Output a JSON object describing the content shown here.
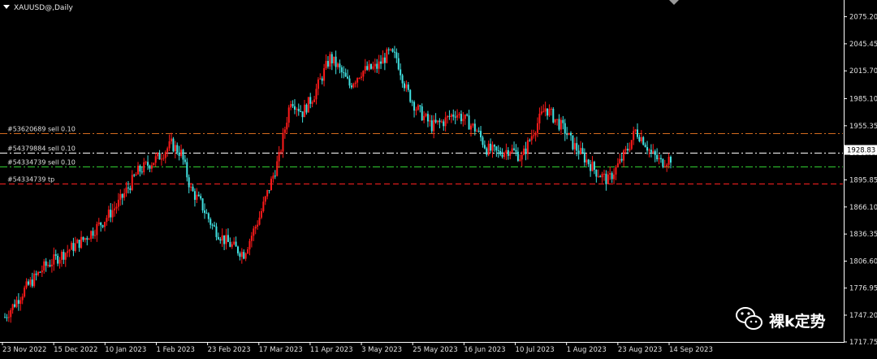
{
  "window": {
    "title": "XAUUSD@,Daily"
  },
  "watermark": {
    "text": "裸k定势"
  },
  "chart_data": {
    "type": "candlestick",
    "symbol": "XAUUSD@",
    "timeframe": "Daily",
    "ylim": [
      1717.75,
      2090
    ],
    "y_ticks": [
      "2075.20",
      "2045.45",
      "2015.70",
      "1985.10",
      "1955.35",
      "1925.60",
      "1895.85",
      "1866.10",
      "1836.35",
      "1806.60",
      "1776.95",
      "1747.20",
      "1717.75"
    ],
    "x_ticks": [
      "23 Nov 2022",
      "15 Dec 2022",
      "10 Jan 2023",
      "1 Feb 2023",
      "23 Feb 2023",
      "17 Mar 2023",
      "11 Apr 2023",
      "3 May 2023",
      "25 May 2023",
      "16 Jun 2023",
      "10 Jul 2023",
      "1 Aug 2023",
      "23 Aug 2023",
      "14 Sep 2023"
    ],
    "current_price": "1928.83",
    "colors": {
      "bull": "#ff1a1a",
      "bear": "#40e0e0",
      "background": "#000000",
      "axis": "#ffffff"
    },
    "key_points": [
      [
        0,
        1745
      ],
      [
        10,
        1775
      ],
      [
        20,
        1800
      ],
      [
        30,
        1815
      ],
      [
        40,
        1830
      ],
      [
        50,
        1850
      ],
      [
        58,
        1870
      ],
      [
        68,
        1905
      ],
      [
        78,
        1920
      ],
      [
        85,
        1935
      ],
      [
        90,
        1925
      ],
      [
        95,
        1885
      ],
      [
        100,
        1870
      ],
      [
        106,
        1845
      ],
      [
        112,
        1830
      ],
      [
        118,
        1820
      ],
      [
        122,
        1815
      ],
      [
        130,
        1855
      ],
      [
        140,
        1920
      ],
      [
        146,
        1985
      ],
      [
        152,
        1970
      ],
      [
        158,
        1990
      ],
      [
        166,
        2030
      ],
      [
        170,
        2020
      ],
      [
        176,
        2000
      ],
      [
        182,
        2015
      ],
      [
        190,
        2020
      ],
      [
        196,
        2035
      ],
      [
        200,
        2030
      ],
      [
        205,
        1995
      ],
      [
        210,
        1975
      ],
      [
        218,
        1955
      ],
      [
        224,
        1960
      ],
      [
        230,
        1970
      ],
      [
        236,
        1960
      ],
      [
        241,
        1950
      ],
      [
        246,
        1930
      ],
      [
        252,
        1925
      ],
      [
        258,
        1930
      ],
      [
        264,
        1920
      ],
      [
        270,
        1950
      ],
      [
        276,
        1975
      ],
      [
        280,
        1965
      ],
      [
        286,
        1950
      ],
      [
        290,
        1935
      ],
      [
        296,
        1920
      ],
      [
        302,
        1905
      ],
      [
        308,
        1895
      ],
      [
        314,
        1915
      ],
      [
        318,
        1930
      ],
      [
        322,
        1950
      ],
      [
        326,
        1940
      ],
      [
        330,
        1925
      ],
      [
        335,
        1915
      ],
      [
        340,
        1920
      ]
    ],
    "orders": [
      {
        "label": "#53620689 sell 0.10",
        "price": 1947.5,
        "color": "#d2691e",
        "style": "dash-dot"
      },
      {
        "label": "#54379884 sell 0.10",
        "price": 1925.6,
        "color": "#ffffff",
        "style": "dash-dot"
      },
      {
        "label": "#54334739 sell 0.10",
        "price": 1911.0,
        "color": "#32cd32",
        "style": "dash-dot"
      },
      {
        "label": "#54334739 tp",
        "price": 1892.0,
        "color": "#ff2020",
        "style": "dash"
      }
    ]
  }
}
